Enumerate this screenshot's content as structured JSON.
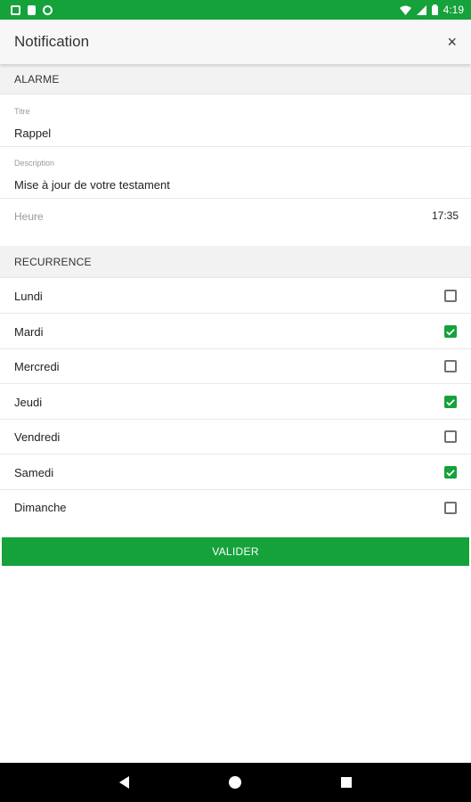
{
  "status_bar": {
    "time": "4:19",
    "left_icons": [
      "notification-square-icon",
      "sd-card-icon",
      "sync-circle-icon"
    ],
    "right_icons": [
      "wifi-icon",
      "signal-icon",
      "battery-icon"
    ]
  },
  "app_bar": {
    "title": "Notification",
    "close_label": "×"
  },
  "alarm_section": {
    "header": "ALARME",
    "title_field": {
      "label": "Titre",
      "value": "Rappel"
    },
    "description_field": {
      "label": "Description",
      "value": "Mise à jour de votre testament"
    },
    "time_field": {
      "label": "Heure",
      "value": "17:35"
    }
  },
  "recurrence_section": {
    "header": "RECURRENCE",
    "days": [
      {
        "label": "Lundi",
        "checked": false
      },
      {
        "label": "Mardi",
        "checked": true
      },
      {
        "label": "Mercredi",
        "checked": false
      },
      {
        "label": "Jeudi",
        "checked": true
      },
      {
        "label": "Vendredi",
        "checked": false
      },
      {
        "label": "Samedi",
        "checked": true
      },
      {
        "label": "Dimanche",
        "checked": false
      }
    ]
  },
  "submit_button": {
    "label": "VALIDER"
  },
  "colors": {
    "accent": "#15a23b",
    "section_bg": "#f2f2f2",
    "nav_bar": "#000000"
  }
}
